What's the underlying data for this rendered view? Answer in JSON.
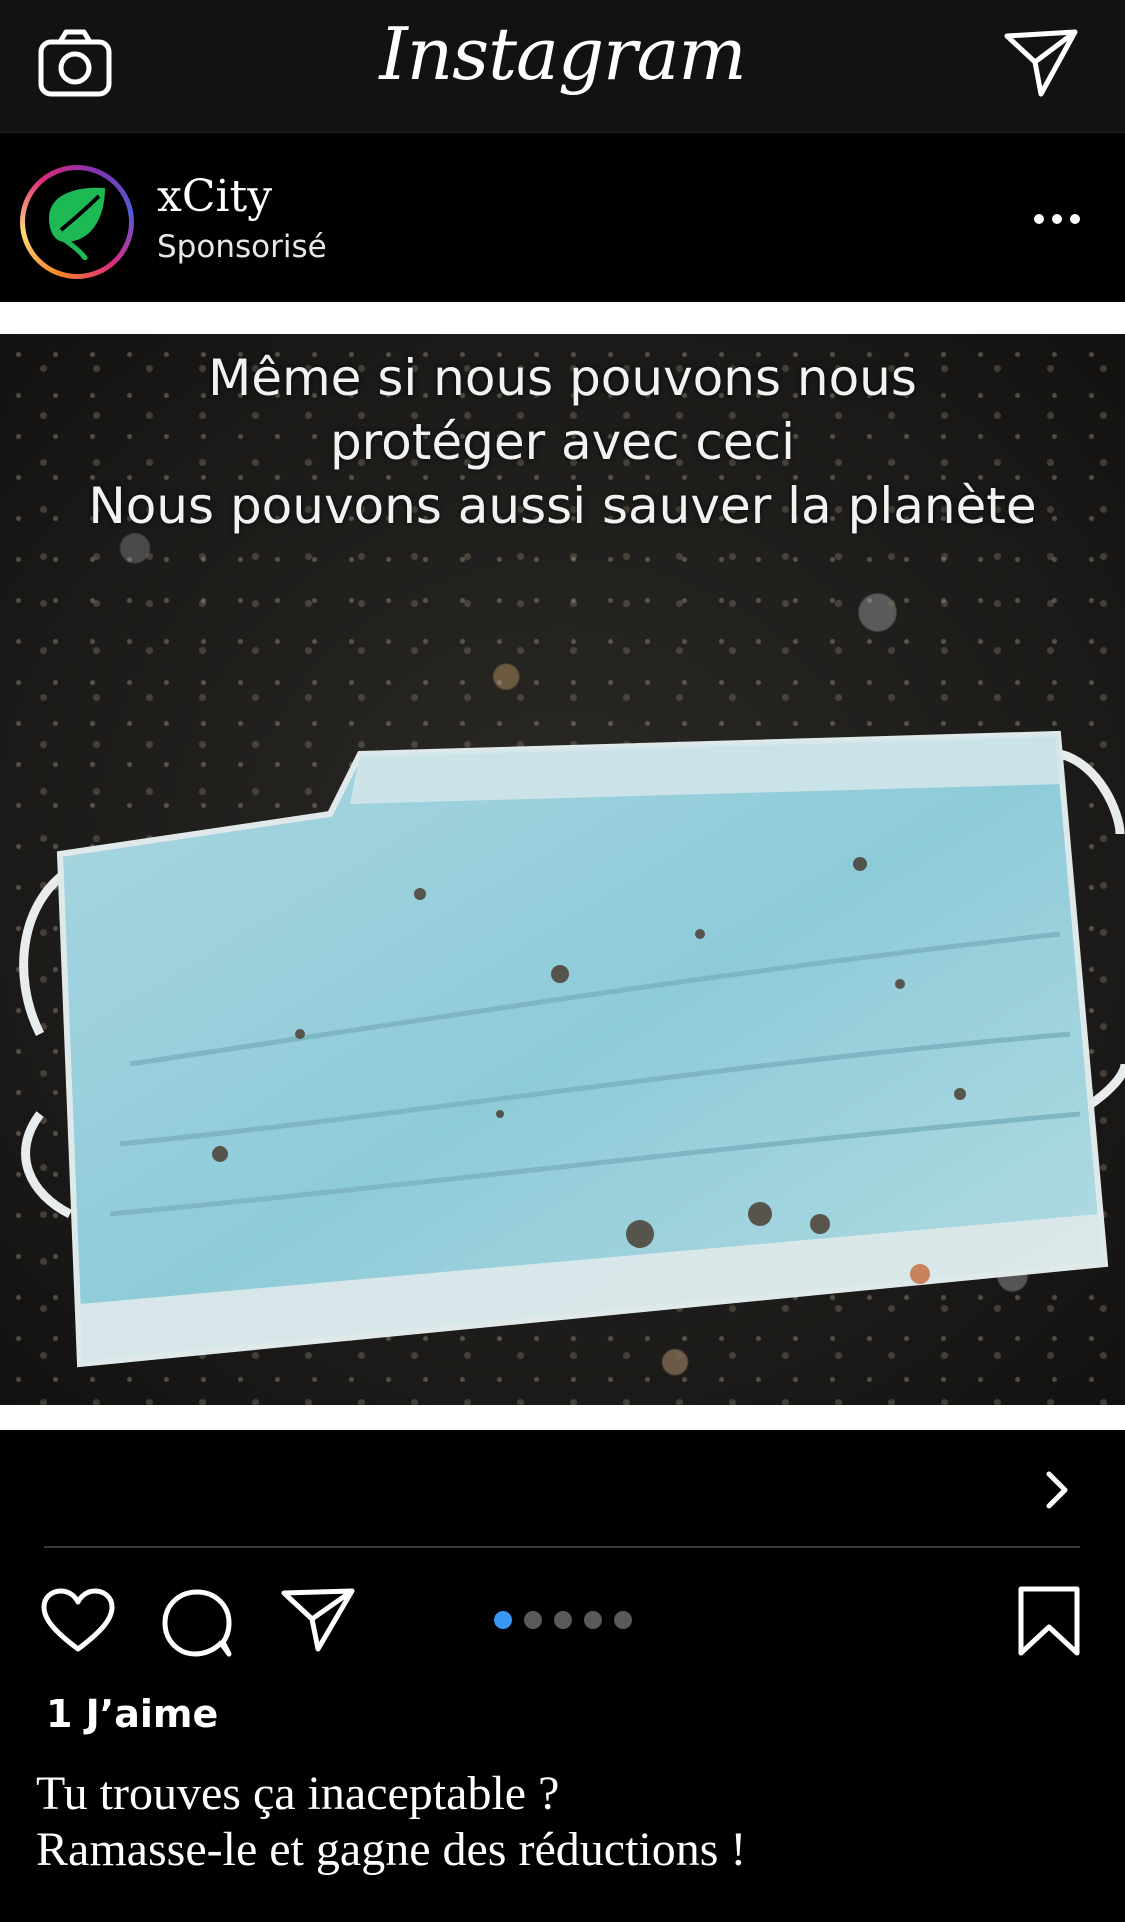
{
  "app": {
    "brand": "Instagram"
  },
  "topbar": {
    "camera_icon": "camera-icon",
    "direct_icon": "paper-plane-icon"
  },
  "post": {
    "account": {
      "username": "xCity",
      "subtitle": "Sponsorisé",
      "avatar_icon": "leaf-icon",
      "avatar_color": "#1db954"
    },
    "more_icon": "more-horizontal-icon",
    "image": {
      "overlay_lines": [
        "Même si nous pouvons nous",
        "protéger avec ceci",
        "Nous pouvons aussi sauver la planète"
      ]
    },
    "next_icon": "chevron-right-icon",
    "actions": {
      "like_icon": "heart-icon",
      "comment_icon": "comment-icon",
      "share_icon": "paper-plane-icon",
      "save_icon": "bookmark-icon"
    },
    "carousel": {
      "total": 5,
      "active_index": 0,
      "active_color": "#3897f0"
    },
    "likes_text": "1 J’aime",
    "caption_lines": [
      "Tu trouves ça inaceptable ?",
      "Ramasse-le et gagne des réductions !"
    ]
  }
}
